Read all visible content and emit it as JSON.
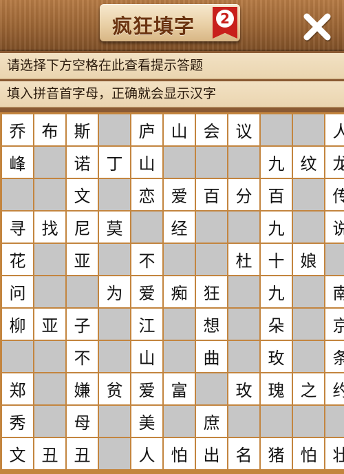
{
  "header": {
    "title": "疯狂填字",
    "level_badge": "2",
    "close_icon": "close-icon"
  },
  "hints": {
    "line1": "请选择下方空格在此查看提示答题",
    "line2": "填入拼音首字母，正确就会显示汉字"
  },
  "colors": {
    "grid_border": "#c3853f",
    "blank_cell": "#c6c6c6",
    "filled_cell": "#ffffff",
    "badge_red": "#c8201c",
    "title_text": "#6b3411"
  },
  "grid": {
    "rows": [
      [
        "乔",
        "布",
        "斯",
        "",
        "庐",
        "山",
        "会",
        "议",
        "",
        "",
        "人"
      ],
      [
        "峰",
        "",
        "诺",
        "丁",
        "山",
        "",
        "",
        "",
        "九",
        "纹",
        "龙"
      ],
      [
        "",
        "",
        "文",
        "",
        "恋",
        "爱",
        "百",
        "分",
        "百",
        "",
        "传"
      ],
      [
        "寻",
        "找",
        "尼",
        "莫",
        "",
        "经",
        "",
        "",
        "九",
        "",
        "说"
      ],
      [
        "花",
        "",
        "亚",
        "",
        "不",
        "",
        "",
        "杜",
        "十",
        "娘",
        ""
      ],
      [
        "问",
        "",
        "",
        "为",
        "爱",
        "痴",
        "狂",
        "",
        "九",
        "",
        "南"
      ],
      [
        "柳",
        "亚",
        "子",
        "",
        "江",
        "",
        "想",
        "",
        "朵",
        "",
        "京"
      ],
      [
        "",
        "",
        "不",
        "",
        "山",
        "",
        "曲",
        "",
        "玫",
        "",
        "条"
      ],
      [
        "郑",
        "",
        "嫌",
        "贫",
        "爱",
        "富",
        "",
        "玫",
        "瑰",
        "之",
        "约"
      ],
      [
        "秀",
        "",
        "母",
        "",
        "美",
        "",
        "庶",
        "",
        "",
        "",
        ""
      ],
      [
        "文",
        "丑",
        "丑",
        "",
        "人",
        "怕",
        "出",
        "名",
        "猪",
        "怕",
        "壮"
      ]
    ]
  }
}
